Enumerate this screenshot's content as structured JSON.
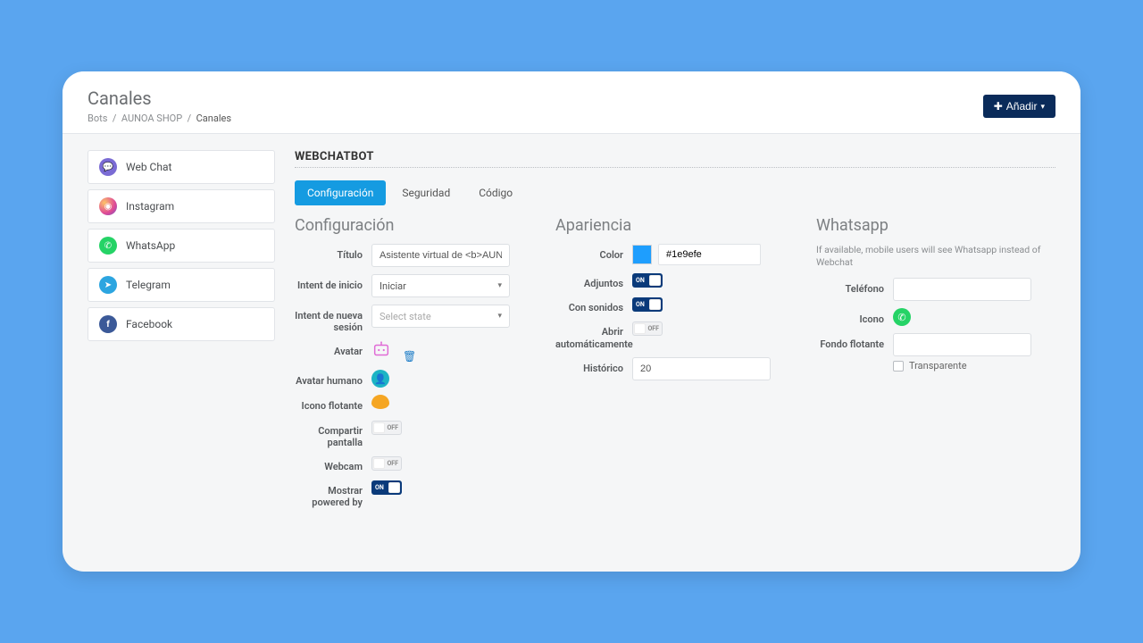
{
  "header": {
    "title": "Canales",
    "breadcrumb": {
      "a": "Bots",
      "b": "AUNOA SHOP",
      "c": "Canales"
    },
    "add_button": "Añadir"
  },
  "sidebar": {
    "items": [
      {
        "label": "Web Chat"
      },
      {
        "label": "Instagram"
      },
      {
        "label": "WhatsApp"
      },
      {
        "label": "Telegram"
      },
      {
        "label": "Facebook"
      }
    ]
  },
  "main": {
    "heading": "WEBCHATBOT",
    "tabs": {
      "config": "Configuración",
      "security": "Seguridad",
      "code": "Código"
    }
  },
  "config": {
    "heading": "Configuración",
    "title_lbl": "Título",
    "title_val": "Asistente virtual de <b>AUNOA S",
    "intent_start_lbl": "Intent de inicio",
    "intent_start_val": "Iniciar",
    "intent_new_lbl": "Intent de nueva sesión",
    "intent_new_val": "Select state",
    "avatar_lbl": "Avatar",
    "avatar_human_lbl": "Avatar humano",
    "float_icon_lbl": "Icono flotante",
    "share_screen_lbl": "Compartir pantalla",
    "webcam_lbl": "Webcam",
    "powered_lbl": "Mostrar powered by"
  },
  "appearance": {
    "heading": "Apariencia",
    "color_lbl": "Color",
    "color_val": "#1e9efe",
    "attachments_lbl": "Adjuntos",
    "sounds_lbl": "Con sonidos",
    "auto_open_lbl": "Abrir automáticamente",
    "history_lbl": "Histórico",
    "history_val": "20"
  },
  "whatsapp": {
    "heading": "Whatsapp",
    "desc": "If available, mobile users will see Whatsapp instead of Webchat",
    "phone_lbl": "Teléfono",
    "icon_lbl": "Icono",
    "bg_lbl": "Fondo flotante",
    "transparent_lbl": "Transparente"
  },
  "toggle": {
    "on": "ON",
    "off": "OFF"
  }
}
